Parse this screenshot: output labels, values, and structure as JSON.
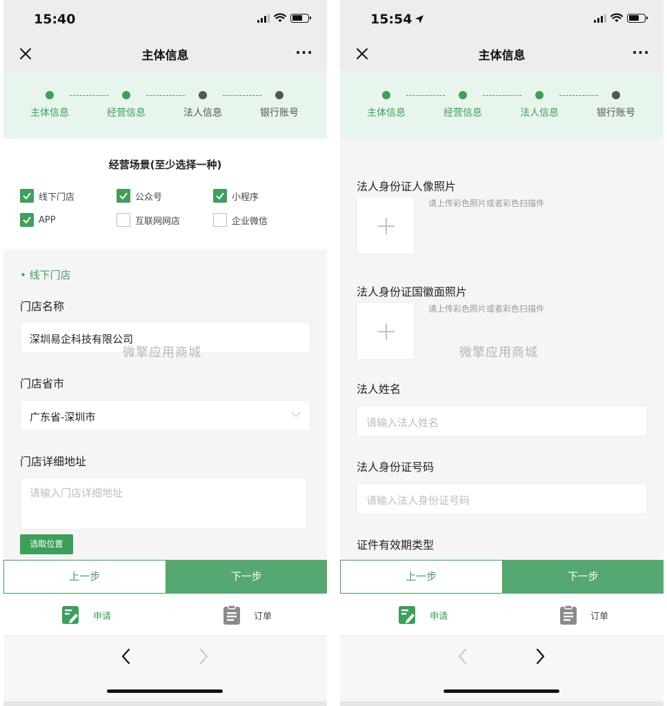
{
  "colors": {
    "accent": "#3d9f5a",
    "button_next": "#55a86f",
    "step_pending": "#555555"
  },
  "left": {
    "status": {
      "time": "15:40"
    },
    "nav": {
      "title": "主体信息",
      "close_icon": "close-icon",
      "more": "···"
    },
    "steps": [
      {
        "label": "主体信息",
        "state": "done"
      },
      {
        "label": "经营信息",
        "state": "done"
      },
      {
        "label": "法人信息",
        "state": "pending"
      },
      {
        "label": "银行账号",
        "state": "pending"
      }
    ],
    "scenes": {
      "title": "经营场景(至少选择一种)",
      "options": [
        {
          "label": "线下门店",
          "checked": true
        },
        {
          "label": "公众号",
          "checked": true
        },
        {
          "label": "小程序",
          "checked": true
        },
        {
          "label": "APP",
          "checked": true
        },
        {
          "label": "互联网网店",
          "checked": false
        },
        {
          "label": "企业微信",
          "checked": false
        }
      ]
    },
    "section_title": "• 线下门店",
    "store_name": {
      "label": "门店名称",
      "value": "深圳易企科技有限公司"
    },
    "store_city": {
      "label": "门店省市",
      "value": "广东省-深圳市"
    },
    "store_address": {
      "label": "门店详细地址",
      "placeholder": "请输入门店详细地址"
    },
    "pick_location": "选取位置",
    "watermark": "微擎应用商城",
    "buttons": {
      "prev": "上一步",
      "next": "下一步"
    },
    "tabs": [
      {
        "label": "申请",
        "icon": "apply-edit-icon",
        "active": true
      },
      {
        "label": "订单",
        "icon": "clipboard-icon",
        "active": false
      }
    ]
  },
  "right": {
    "status": {
      "time": "15:54"
    },
    "nav": {
      "title": "主体信息",
      "close_icon": "close-icon",
      "more": "···"
    },
    "steps": [
      {
        "label": "主体信息",
        "state": "done"
      },
      {
        "label": "经营信息",
        "state": "done"
      },
      {
        "label": "法人信息",
        "state": "done"
      },
      {
        "label": "银行账号",
        "state": "pending"
      }
    ],
    "id_front": {
      "label": "法人身份证人像照片",
      "hint": "请上传彩色照片或者彩色扫描件"
    },
    "id_back": {
      "label": "法人身份证国徽面照片",
      "hint": "请上传彩色照片或者彩色扫描件"
    },
    "legal_name": {
      "label": "法人姓名",
      "placeholder": "请输入法人姓名"
    },
    "legal_id": {
      "label": "法人身份证号码",
      "placeholder": "请输入法人身份证号码"
    },
    "validity_type": {
      "label": "证件有效期类型"
    },
    "watermark": "微擎应用商城",
    "buttons": {
      "prev": "上一步",
      "next": "下一步"
    },
    "tabs": [
      {
        "label": "申请",
        "icon": "apply-edit-icon",
        "active": true
      },
      {
        "label": "订单",
        "icon": "clipboard-icon",
        "active": false
      }
    ]
  }
}
